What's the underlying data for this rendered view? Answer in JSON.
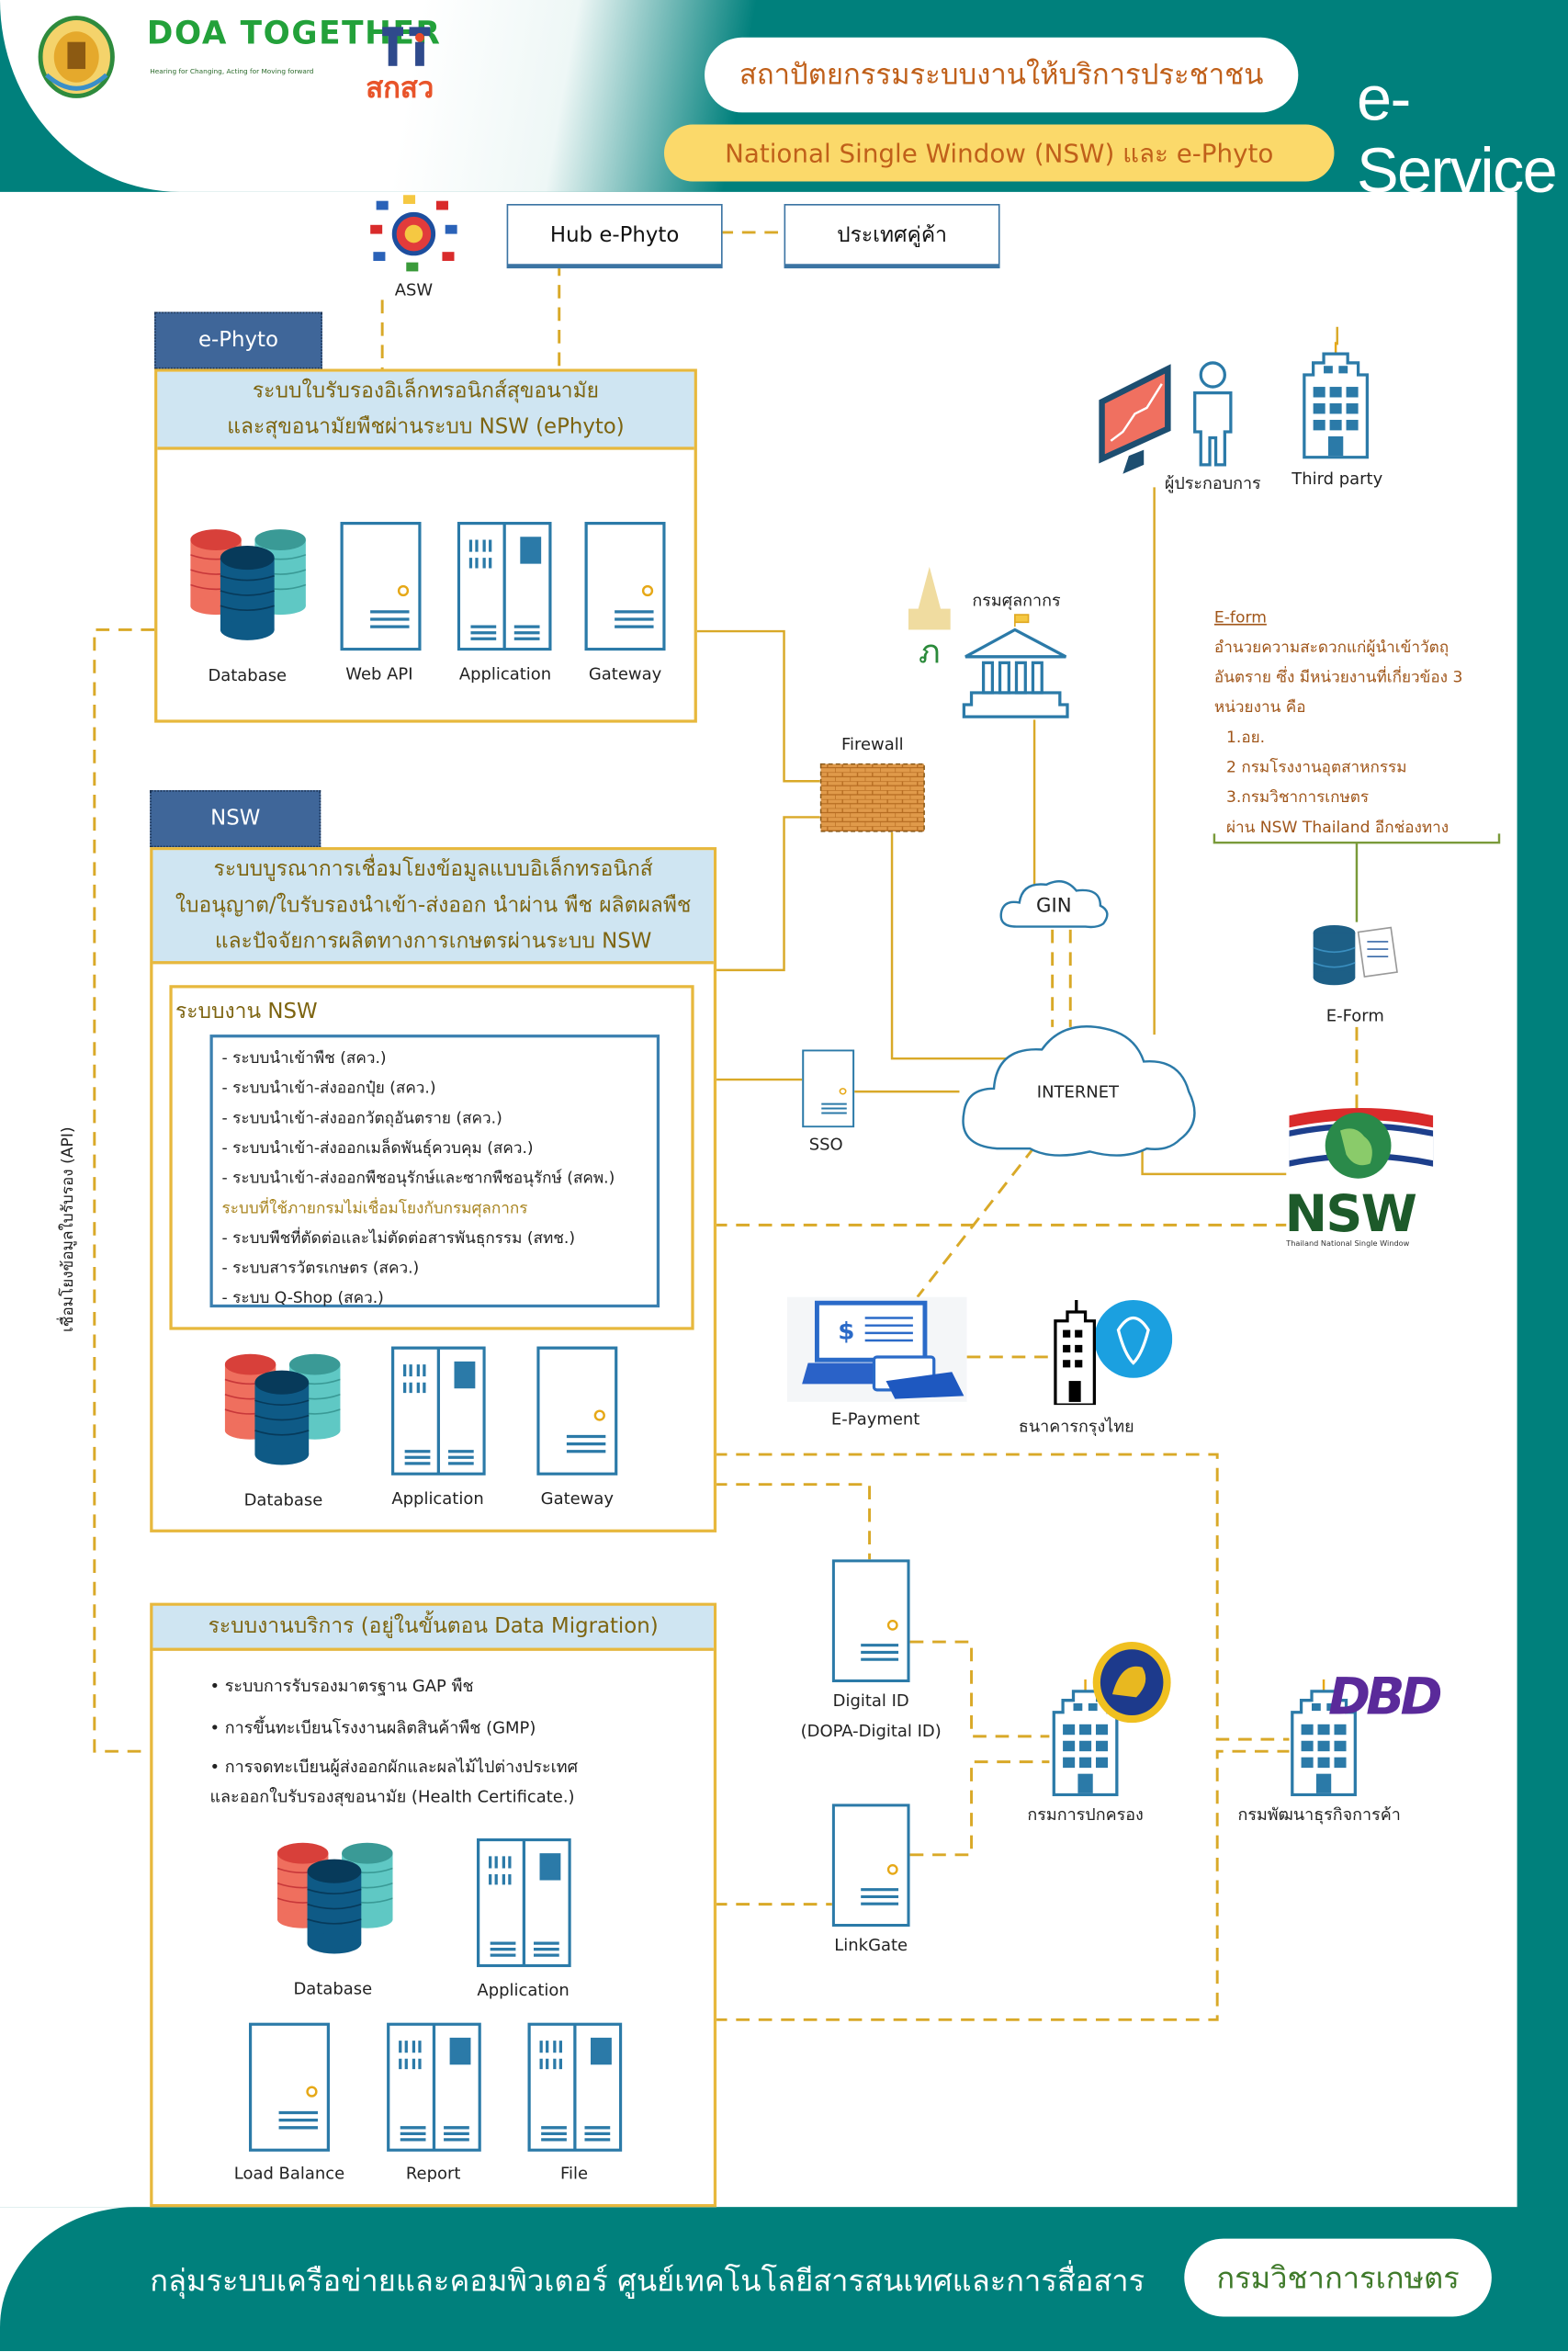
{
  "header": {
    "title": "สถาปัตยกรรมระบบงานให้บริการประชาชน",
    "subtitle": "National Single Window (NSW) และ e-Phyto",
    "brand": "e-Service",
    "logos": {
      "doa_seal": "กรมวิชาการเกษตร",
      "doa_together": "DOA TOGETHER",
      "doa_tagline": "Hearing for Changing, Acting for Moving forward",
      "tsri": "สกสว"
    }
  },
  "top": {
    "asw_label": "ASW",
    "hub_label": "Hub e-Phyto",
    "partner_label": "ประเทศคู่ค้า"
  },
  "ephyto": {
    "tag": "e-Phyto",
    "title_lines": [
      "ระบบใบรับรองอิเล็กทรอนิกส์สุขอนามัย",
      "และสุขอนามัยพืชผ่านระบบ NSW (ePhyto)"
    ],
    "components": [
      "Database",
      "Web API",
      "Application",
      "Gateway"
    ]
  },
  "nsw": {
    "tag": "NSW",
    "title_lines": [
      "ระบบบูรณาการเชื่อมโยงข้อมูลแบบอิเล็กทรอนิกส์",
      "ใบอนุญาต/ใบรับรองนำเข้า-ส่งออก นำผ่าน พืช ผลิตผลพืช",
      "และปัจจัยการผลิตทางการเกษตรผ่านระบบ NSW"
    ],
    "systems_title": "ระบบงาน NSW",
    "systems": [
      "- ระบบนำเข้าพืช (สคว.)",
      "- ระบบนำเข้า-ส่งออกปุ๋ย (สคว.)",
      "- ระบบนำเข้า-ส่งออกวัตถุอันตราย (สคว.)",
      "- ระบบนำเข้า-ส่งออกเมล็ดพันธุ์ควบคุม (สคว.)",
      "- ระบบนำเข้า-ส่งออกพืชอนุรักษ์และซากพืชอนุรักษ์ (สคพ.)"
    ],
    "internal_note": "ระบบที่ใช้ภายกรมไม่เชื่อมโยงกับกรมศุลกากร",
    "internal_systems": [
      "- ระบบพืชที่ตัดต่อและไม่ตัดต่อสารพันธุกรรม (สทช.)",
      "- ระบบสารวัตรเกษตร (สคว.)",
      "- ระบบ Q-Shop (สคว.)"
    ],
    "components": [
      "Database",
      "Application",
      "Gateway"
    ]
  },
  "service": {
    "title": "ระบบงานบริการ  (อยู่ในขั้นตอน Data Migration)",
    "bullets": [
      "• ระบบการรับรองมาตรฐาน GAP พืช",
      "• การขึ้นทะเบียนโรงงานผลิตสินค้าพืช (GMP)",
      "• การจดทะเบียนผู้ส่งออกผักและผลไม้ไปต่างประเทศ",
      "และออกใบรับรองสุขอนามัย (Health Certificate.)"
    ],
    "components": [
      "Database",
      "Application",
      "Load Balance",
      "Report",
      "File"
    ]
  },
  "side_label": "เชื่อมโยงข้อมูลใบรับรอง (API)",
  "network": {
    "firewall": "Firewall",
    "customs": "กรมศุลกากร",
    "gin": "GIN",
    "internet": "INTERNET",
    "sso": "SSO",
    "operator": "ผู้ประกอบการ",
    "third_party": "Third party",
    "eform_icon_label": "E-Form",
    "nsw_logo": "NSW",
    "nsw_logo_sub": "Thailand National Single Window",
    "epayment": "E-Payment",
    "ktb": "ธนาคารกรุงไทย",
    "digital_id": "Digital ID",
    "digital_id_sub": "(DOPA-Digital ID)",
    "linkgate": "LinkGate",
    "dopa": "กรมการปกครอง",
    "dbd": "กรมพัฒนาธุรกิจการค้า",
    "dbd_logo": "DBD"
  },
  "eform": {
    "heading": "E-form",
    "lines": [
      "อำนวยความสะดวกแก่ผู้นำเข้าวัตถุ",
      "อันตราย ซึ่ง มีหน่วยงานที่เกี่ยวข้อง 3",
      "หน่วยงาน คือ"
    ],
    "agencies": [
      "1.อย.",
      "2 กรมโรงงานอุตสาหกรรม",
      "3.กรมวิชาการเกษตร",
      "ผ่าน NSW Thailand อีกช่องทาง"
    ]
  },
  "footer": {
    "text": "กลุ่มระบบเครือข่ายและคอมพิวเตอร์  ศูนย์เทคโนโลยีสารสนเทศและการสื่อสาร",
    "org": "กรมวิชาการเกษตร"
  },
  "colors": {
    "teal": "#00807c",
    "gold_line": "#d9a928",
    "panel_border": "#e7b83d",
    "panel_header": "#cfe5f2",
    "tag_blue": "#3f6699",
    "title_orange": "#c0601a",
    "subtitle_yellow": "#fbd96a",
    "icon_blue": "#2b7aa8"
  }
}
